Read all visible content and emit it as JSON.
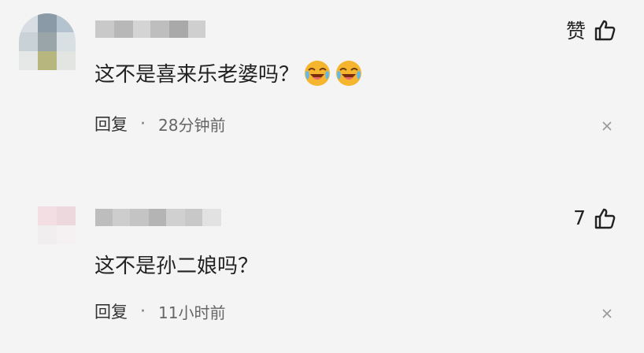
{
  "comments": [
    {
      "like_label": "赞",
      "text": "这不是喜来乐老婆吗？",
      "emoji": "laughing-crying-emoji",
      "reply_label": "回复",
      "separator": "·",
      "time": "28分钟前"
    },
    {
      "like_label": "7",
      "text": "这不是孙二娘吗？",
      "reply_label": "回复",
      "separator": "·",
      "time": "11小时前"
    }
  ],
  "colors": {
    "background": "#f4f4f4",
    "text": "#222222",
    "meta": "#666666",
    "emoji": "#f5b52e"
  }
}
